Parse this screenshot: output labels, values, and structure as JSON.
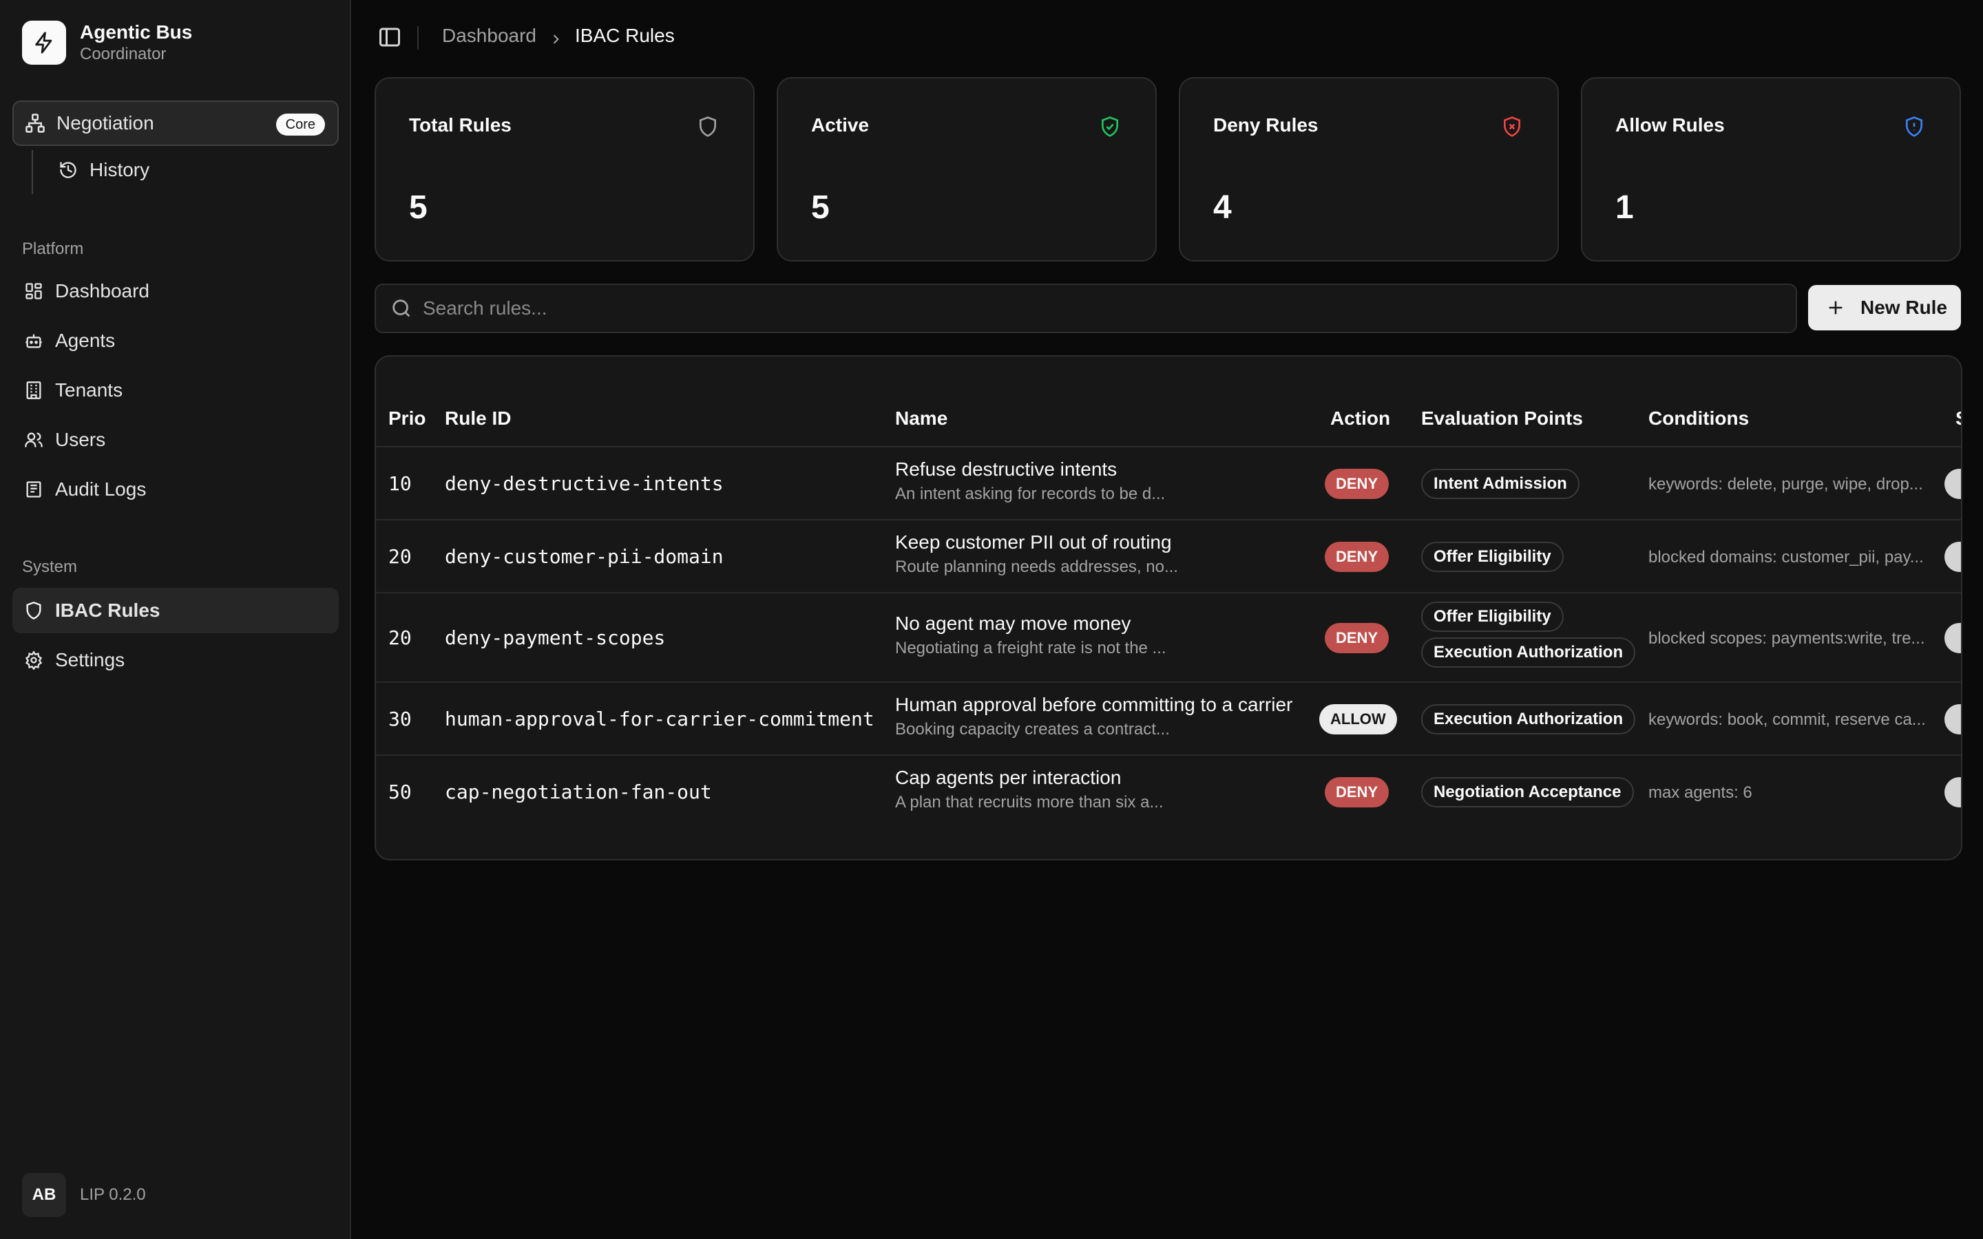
{
  "brand": {
    "title": "Agentic Bus",
    "subtitle": "Coordinator"
  },
  "sidebar": {
    "top_item": {
      "label": "Negotiation",
      "badge": "Core",
      "icon": "workflow-icon"
    },
    "sub_item": {
      "label": "History",
      "icon": "history-icon"
    },
    "platform_label": "Platform",
    "platform_items": [
      {
        "label": "Dashboard",
        "icon": "dashboard-icon"
      },
      {
        "label": "Agents",
        "icon": "bot-icon"
      },
      {
        "label": "Tenants",
        "icon": "building-icon"
      },
      {
        "label": "Users",
        "icon": "users-icon"
      },
      {
        "label": "Audit Logs",
        "icon": "logs-icon"
      }
    ],
    "system_label": "System",
    "system_items": [
      {
        "label": "IBAC Rules",
        "icon": "shield-icon",
        "active": true
      },
      {
        "label": "Settings",
        "icon": "gear-icon"
      }
    ],
    "footer": {
      "avatar": "AB",
      "version": "LIP 0.2.0"
    }
  },
  "header": {
    "breadcrumb": {
      "parent": "Dashboard",
      "current": "IBAC Rules"
    }
  },
  "stats": [
    {
      "label": "Total Rules",
      "value": "5",
      "icon": "shield-icon",
      "color": "#a3a3a3"
    },
    {
      "label": "Active",
      "value": "5",
      "icon": "shield-check-icon",
      "color": "#22c55e"
    },
    {
      "label": "Deny Rules",
      "value": "4",
      "icon": "shield-x-icon",
      "color": "#ef4444"
    },
    {
      "label": "Allow Rules",
      "value": "1",
      "icon": "shield-alert-icon",
      "color": "#3b82f6"
    }
  ],
  "search": {
    "placeholder": "Search rules..."
  },
  "new_rule_label": "New Rule",
  "table": {
    "columns": [
      "Prio",
      "Rule ID",
      "Name",
      "Action",
      "Evaluation Points",
      "Conditions",
      "S"
    ],
    "rows": [
      {
        "prio": "10",
        "rule_id": "deny-destructive-intents",
        "name": "Refuse destructive intents",
        "desc": "An intent asking for records to be d...",
        "action": "DENY",
        "eval": [
          "Intent Admission"
        ],
        "conditions": "keywords: delete, purge, wipe, drop..."
      },
      {
        "prio": "20",
        "rule_id": "deny-customer-pii-domain",
        "name": "Keep customer PII out of routing",
        "desc": "Route planning needs addresses, no...",
        "action": "DENY",
        "eval": [
          "Offer Eligibility"
        ],
        "conditions": "blocked domains: customer_pii, pay..."
      },
      {
        "prio": "20",
        "rule_id": "deny-payment-scopes",
        "name": "No agent may move money",
        "desc": "Negotiating a freight rate is not the ...",
        "action": "DENY",
        "eval": [
          "Offer Eligibility",
          "Execution Authorization"
        ],
        "conditions": "blocked scopes: payments:write, tre..."
      },
      {
        "prio": "30",
        "rule_id": "human-approval-for-carrier-commitment",
        "name": "Human approval before committing to a carrier",
        "desc": "Booking capacity creates a contract...",
        "action": "ALLOW",
        "eval": [
          "Execution Authorization"
        ],
        "conditions": "keywords: book, commit, reserve ca..."
      },
      {
        "prio": "50",
        "rule_id": "cap-negotiation-fan-out",
        "name": "Cap agents per interaction",
        "desc": "A plan that recruits more than six a...",
        "action": "DENY",
        "eval": [
          "Negotiation Acceptance"
        ],
        "conditions": "max agents: 6"
      }
    ]
  }
}
